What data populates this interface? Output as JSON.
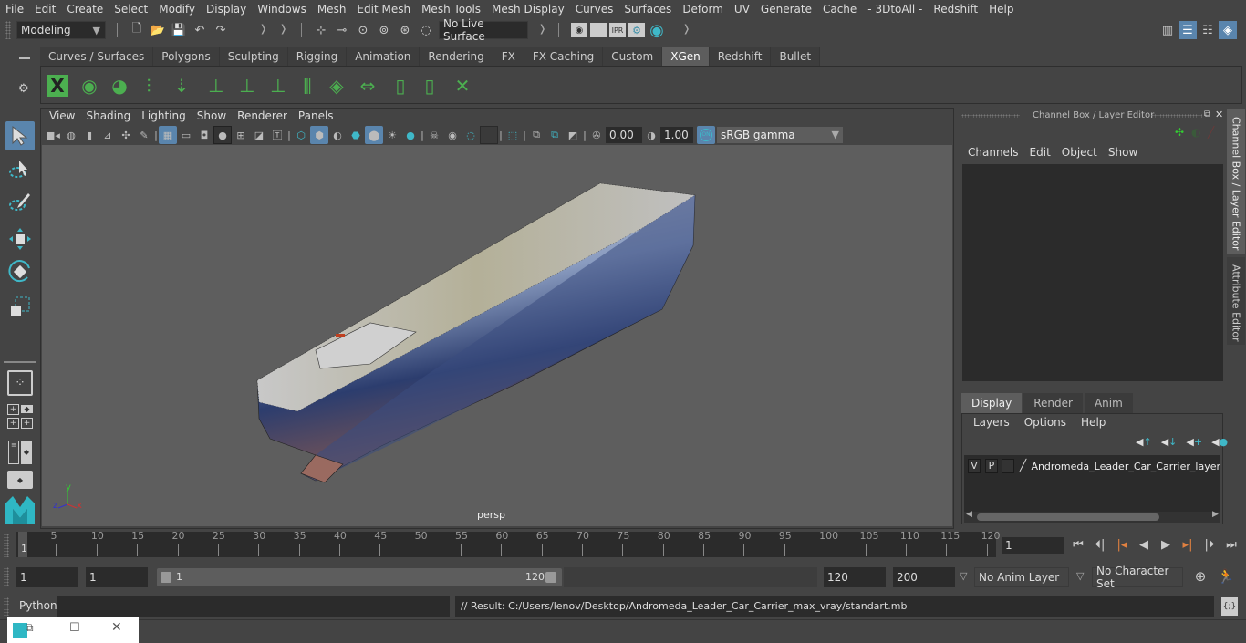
{
  "menubar": [
    "File",
    "Edit",
    "Create",
    "Select",
    "Modify",
    "Display",
    "Windows",
    "Mesh",
    "Edit Mesh",
    "Mesh Tools",
    "Mesh Display",
    "Curves",
    "Surfaces",
    "Deform",
    "UV",
    "Generate",
    "Cache",
    "- 3DtoAll -",
    "Redshift",
    "Help"
  ],
  "statusline": {
    "mode": "Modeling",
    "live_surface": "No Live Surface",
    "render_icons": [
      "render-view-icon",
      "render-frame-icon",
      "ipr-render-icon",
      "render-settings-icon",
      "hypershade-icon"
    ],
    "ipr_label": "IPR"
  },
  "shelf": {
    "tabs": [
      "Curves / Surfaces",
      "Polygons",
      "Sculpting",
      "Rigging",
      "Animation",
      "Rendering",
      "FX",
      "FX Caching",
      "Custom",
      "XGen",
      "Redshift",
      "Bullet"
    ],
    "active_tab": "XGen",
    "icons": [
      "xgen-editor-icon",
      "toggle-preview-icon",
      "hide-preview-icon",
      "add-guides-icon",
      "place-guides-icon",
      "add-guide-icon",
      "select-guide-icon",
      "lock-guide-icon",
      "sculpt-guides-icon",
      "bake-guides-icon",
      "flip-guides-icon",
      "create-collection-icon",
      "delete-collection-icon",
      "delete-guides-icon"
    ]
  },
  "toolbox": [
    "select-tool",
    "lasso-tool",
    "paint-select-tool",
    "move-tool",
    "rotate-tool",
    "scale-tool",
    "single-perspective-layout",
    "four-view-layout",
    "outliner-persp-layout",
    "persp-graph-layout"
  ],
  "viewport": {
    "menu": [
      "View",
      "Shading",
      "Lighting",
      "Show",
      "Renderer",
      "Panels"
    ],
    "exposure": "0.00",
    "gamma": "1.00",
    "color_mgmt": "ON",
    "color_space": "sRGB gamma",
    "camera_label": "persp",
    "axis": {
      "x": "x",
      "y": "y",
      "z": "z"
    }
  },
  "channel_box": {
    "title": "Channel Box / Layer Editor",
    "menu": [
      "Channels",
      "Edit",
      "Object",
      "Show"
    ],
    "side_tabs": [
      "Channel Box / Layer Editor",
      "Attribute Editor"
    ]
  },
  "layer_editor": {
    "tabs": [
      "Display",
      "Render",
      "Anim"
    ],
    "active_tab": "Display",
    "menu": [
      "Layers",
      "Options",
      "Help"
    ],
    "layers": [
      {
        "v": "V",
        "p": "P",
        "name": "Andromeda_Leader_Car_Carrier_layer"
      }
    ]
  },
  "timeline": {
    "ticks": [
      5,
      10,
      15,
      20,
      25,
      30,
      35,
      40,
      45,
      50,
      55,
      60,
      65,
      70,
      75,
      80,
      85,
      90,
      95,
      100,
      105,
      110,
      115,
      120
    ],
    "start_label": "1",
    "current_frame": "1"
  },
  "range": {
    "start": "1",
    "playback_start": "1",
    "slider_start": "1",
    "slider_end": "120",
    "playback_end": "120",
    "end": "200",
    "anim_layer": "No Anim Layer",
    "character_set": "No Character Set"
  },
  "cmdline": {
    "language": "Python",
    "input": "",
    "result": "// Result: C:/Users/lenov/Desktop/Andromeda_Leader_Car_Carrier_max_vray/standart.mb"
  },
  "colors": {
    "accent": "#5a85ad",
    "teal": "#3fb8c8",
    "xgen_green": "#4caf50",
    "key_orange": "#e08040"
  }
}
